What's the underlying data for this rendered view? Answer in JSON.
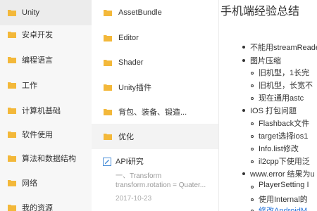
{
  "categories": [
    {
      "label": "Unity",
      "active": true
    },
    {
      "label": "安卓开发"
    },
    {
      "label": "编程语言"
    },
    {
      "label": "工作"
    },
    {
      "label": "计算机基础"
    },
    {
      "label": "软件使用"
    },
    {
      "label": "算法和数据结构"
    },
    {
      "label": "网络"
    },
    {
      "label": "我的资源"
    }
  ],
  "notes": [
    {
      "label": "AssetBundle"
    },
    {
      "label": "Editor"
    },
    {
      "label": "Shader"
    },
    {
      "label": "Unity插件"
    },
    {
      "label": "背包、装备、锻造..."
    },
    {
      "label": "优化",
      "active": true
    }
  ],
  "doc": {
    "title": "API研究",
    "snippet1": "一、Transform",
    "snippet2": "transform.rotation = Quater...",
    "date": "2017-10-23"
  },
  "article": {
    "title": "手机端经验总结",
    "lines": [
      "不能用streamReader",
      "图片压缩",
      "旧机型，1长完",
      "旧机型，长宽不",
      "现在通用astc",
      "IOS 打包问题",
      "Flashback文件",
      "target选择ios1",
      "Info.list修改",
      "il2cpp下使用泛",
      "www.error 结果为u",
      "PlayerSetting I",
      "使用Internal的",
      "修改AndroidM"
    ]
  },
  "colors": {
    "link": "#1e6fd9",
    "folder": "#f3b83a"
  }
}
